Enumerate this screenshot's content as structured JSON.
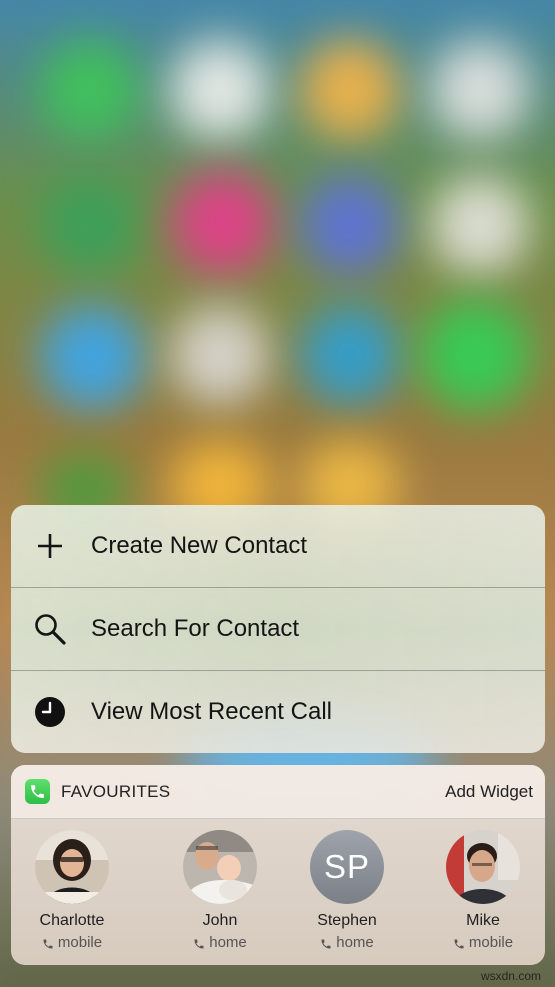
{
  "quick_actions": [
    {
      "label": "Create New Contact",
      "icon": "plus-icon"
    },
    {
      "label": "Search For Contact",
      "icon": "search-icon"
    },
    {
      "label": "View Most Recent Call",
      "icon": "clock-icon"
    }
  ],
  "widget": {
    "app_icon": "phone-app-icon",
    "title": "FAVOURITES",
    "add_label": "Add Widget",
    "contacts": [
      {
        "name": "Charlotte",
        "type": "mobile",
        "avatar": "photo"
      },
      {
        "name": "John",
        "type": "home",
        "avatar": "photo"
      },
      {
        "name": "Stephen",
        "type": "home",
        "avatar": "initials",
        "initials": "SP"
      },
      {
        "name": "Mike",
        "type": "mobile",
        "avatar": "photo"
      }
    ]
  },
  "watermark": "wsxdn.com",
  "colors": {
    "phone_green": "#3fcf57",
    "text_dark": "#141414",
    "initials_gray": "#8d9198"
  }
}
